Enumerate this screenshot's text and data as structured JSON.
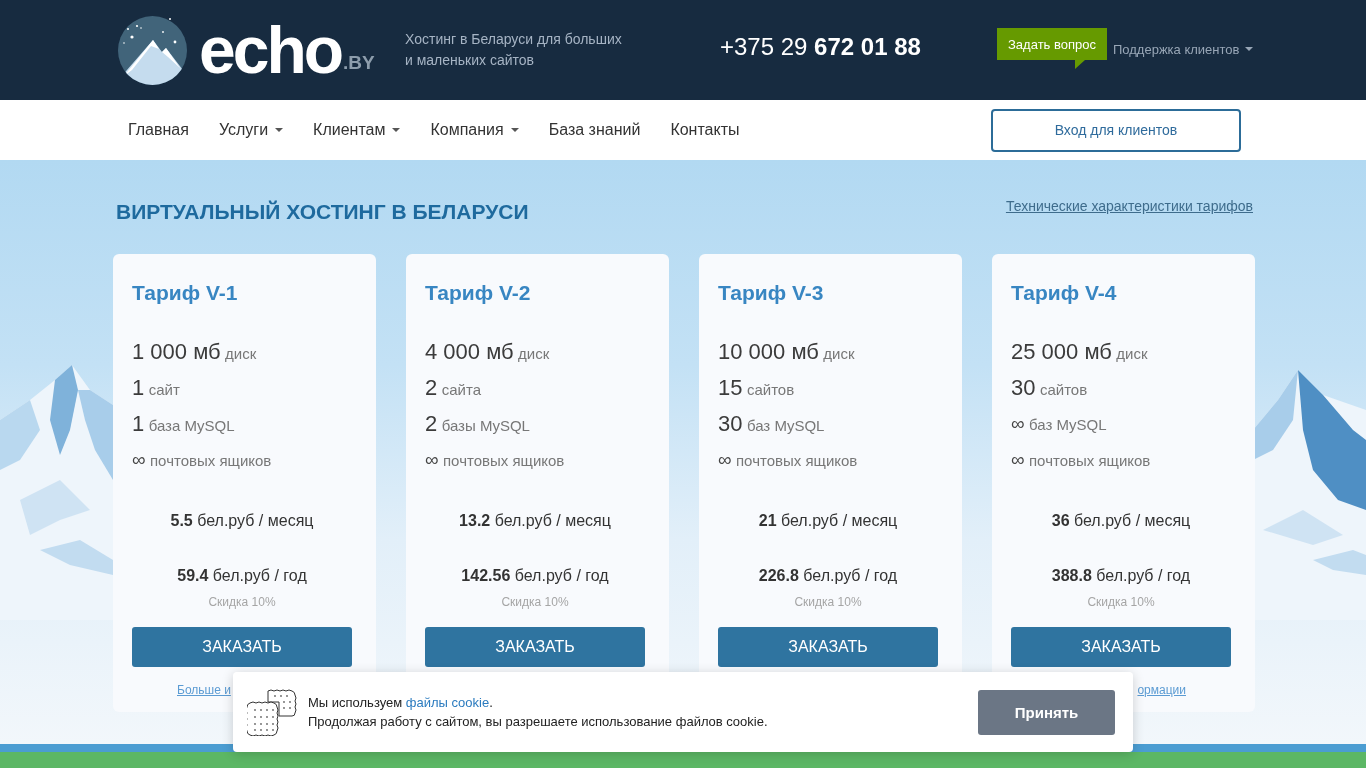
{
  "header": {
    "logo": {
      "name": "echo",
      "suffix": ".BY"
    },
    "tagline": [
      "Хостинг в Беларуси для больших",
      "и маленьких сайтов"
    ],
    "phone": "+375 29 **672 01 88**",
    "ask_button": "Задать вопрос",
    "support_menu": {
      "label": "Поддержка клиентов",
      "dropdown": true
    }
  },
  "nav": {
    "items": [
      {
        "label": "Главная",
        "dropdown": false
      },
      {
        "label": "Услуги",
        "dropdown": true
      },
      {
        "label": "Клиентам",
        "dropdown": true
      },
      {
        "label": "Компания",
        "dropdown": true
      },
      {
        "label": "База знаний",
        "dropdown": false
      },
      {
        "label": "Контакты",
        "dropdown": false
      }
    ],
    "login_button": "Вход для клиентов"
  },
  "hero": {
    "title": "ВИРТУАЛЬНЫЙ ХОСТИНГ В БЕЛАРУСИ",
    "specs_link": "Технические характеристики тарифов"
  },
  "plans": [
    {
      "title": "Тариф **V-1**",
      "specs": [
        {
          "kind": "amount",
          "value": "1 000 мб",
          "unit": "диск"
        },
        {
          "kind": "amount",
          "value": "1",
          "unit": "сайт"
        },
        {
          "kind": "amount",
          "value": "1",
          "unit": "база MySQL"
        },
        {
          "kind": "unlimited",
          "value": "∞",
          "unit": "почтовых ящиков"
        }
      ],
      "monthly": "**5.5** бел.руб / месяц",
      "yearly": "**59.4** бел.руб / год",
      "discount": "Скидка 10%",
      "order_button": "ЗАКАЗАТЬ",
      "more_link": "Больше и"
    },
    {
      "title": "Тариф **V-2**",
      "specs": [
        {
          "kind": "amount",
          "value": "4 000 мб",
          "unit": "диск"
        },
        {
          "kind": "amount",
          "value": "2",
          "unit": "сайта"
        },
        {
          "kind": "amount",
          "value": "2",
          "unit": "базы MySQL"
        },
        {
          "kind": "unlimited",
          "value": "∞",
          "unit": "почтовых ящиков"
        }
      ],
      "monthly": "**13.2** бел.руб / месяц",
      "yearly": "**142.56** бел.руб / год",
      "discount": "Скидка 10%",
      "order_button": "ЗАКАЗАТЬ"
    },
    {
      "title": "Тариф **V-3**",
      "specs": [
        {
          "kind": "amount",
          "value": "10 000 мб",
          "unit": "диск"
        },
        {
          "kind": "amount",
          "value": "15",
          "unit": "сайтов"
        },
        {
          "kind": "amount",
          "value": "30",
          "unit": "баз MySQL"
        },
        {
          "kind": "unlimited",
          "value": "∞",
          "unit": "почтовых ящиков"
        }
      ],
      "monthly": "**21** бел.руб / месяц",
      "yearly": "**226.8** бел.руб / год",
      "discount": "Скидка 10%",
      "order_button": "ЗАКАЗАТЬ"
    },
    {
      "title": "Тариф **V-4**",
      "specs": [
        {
          "kind": "amount",
          "value": "25 000 мб",
          "unit": "диск"
        },
        {
          "kind": "amount",
          "value": "30",
          "unit": "сайтов"
        },
        {
          "kind": "unlimited",
          "value": "∞",
          "unit": "баз MySQL"
        },
        {
          "kind": "unlimited",
          "value": "∞",
          "unit": "почтовых ящиков"
        }
      ],
      "monthly": "**36** бел.руб / месяц",
      "yearly": "**388.8** бел.руб / год",
      "discount": "Скидка 10%",
      "order_button": "ЗАКАЗАТЬ",
      "more_link": "ормации"
    }
  ],
  "cookie_banner": {
    "text_before": "Мы используем",
    "link": "файлы cookie",
    "text_after": ".",
    "line_2": "Продолжая работу с сайтом, вы разрешаете использование файлов cookie.",
    "accept_button": "Принять"
  }
}
